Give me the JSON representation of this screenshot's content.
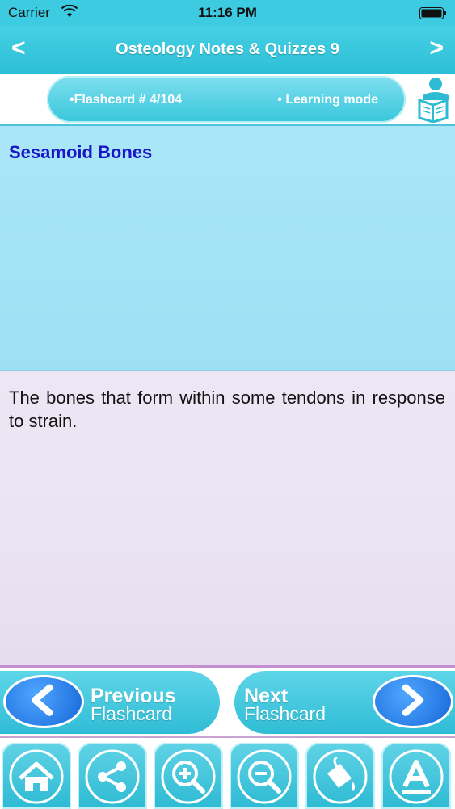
{
  "status_bar": {
    "carrier": "Carrier",
    "time": "11:16 PM"
  },
  "nav": {
    "back_label": "<",
    "title": "Osteology Notes & Quizzes 9",
    "forward_label": ">"
  },
  "info": {
    "counter": "•Flashcard #  4/104",
    "mode": "• Learning mode"
  },
  "card": {
    "topic": "Sesamoid Bones",
    "answer": "The bones that form within some tendons in response to strain."
  },
  "flash_nav": {
    "previous_word": "Previous",
    "previous_sub": "Flashcard",
    "next_word": "Next",
    "next_sub": "Flashcard"
  },
  "toolbar_icons": [
    "home-icon",
    "share-icon",
    "zoom-in-icon",
    "zoom-out-icon",
    "paint-bucket-icon",
    "font-icon"
  ],
  "colors": {
    "accent": "#3ccbe0",
    "topic": "#1a16c6",
    "question_bg": "#a6e5f7",
    "answer_bg": "#ebe5f3",
    "circle_button": "#1f72e0"
  }
}
